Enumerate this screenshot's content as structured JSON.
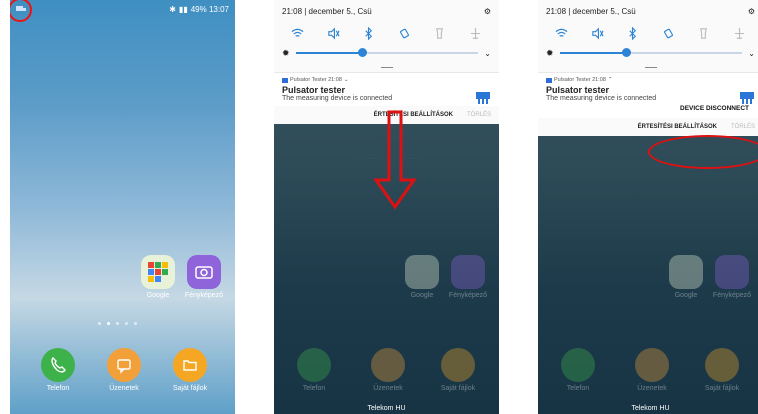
{
  "screen1": {
    "status_right": "49% 13:07",
    "apps_mid": [
      {
        "label": "Google",
        "icon": "google-folder-icon"
      },
      {
        "label": "Fényképező",
        "icon": "camera-icon"
      }
    ],
    "dock": [
      {
        "label": "Telefon",
        "icon": "phone-icon",
        "color": "#3db14a"
      },
      {
        "label": "Üzenetek",
        "icon": "message-icon",
        "color": "#f1a03a"
      },
      {
        "label": "Saját fájlok",
        "icon": "folder-icon",
        "color": "#f5a623"
      }
    ]
  },
  "panel": {
    "time_date": "21:08 | december 5., Csü",
    "notification": {
      "app_line_screen2": "Pulsator Tester  21:08",
      "app_line_screen3": "Pulsator Tester  21:08",
      "title": "Pulsator tester",
      "text": "The measuring device is connected"
    },
    "settings_label": "ÉRTESÍTÉSI BEÁLLÍTÁSOK",
    "clear_label": "TÖRLÉS",
    "disconnect_label": "DEVICE DISCONNECT",
    "carrier": "Telekom HU"
  },
  "colors": {
    "accent": "#2d84d6",
    "annotation": "#dd1111"
  }
}
